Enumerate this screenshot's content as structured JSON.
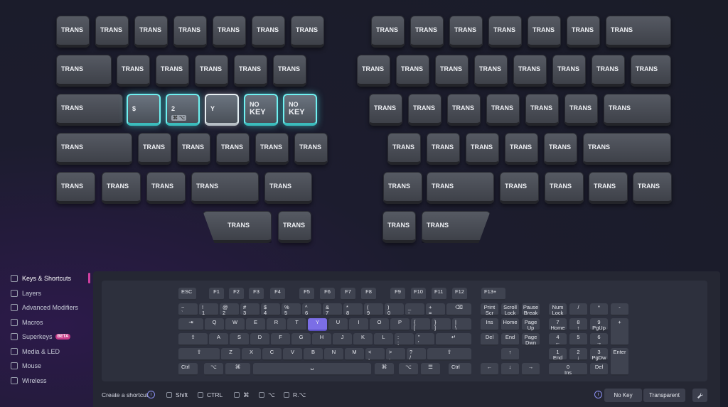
{
  "top_keyboard": {
    "left_half": [
      [
        "TRANS",
        "TRANS",
        "TRANS",
        "TRANS",
        "TRANS",
        "TRANS",
        "TRANS"
      ],
      [
        "TRANS",
        "TRANS",
        "TRANS",
        "TRANS",
        "TRANS",
        "TRANS"
      ],
      [
        "TRANS",
        "$",
        "2",
        "Y",
        "NO KEY",
        "NO KEY"
      ],
      [
        "TRANS",
        "TRANS",
        "TRANS",
        "TRANS",
        "TRANS",
        "TRANS"
      ],
      [
        "TRANS",
        "TRANS",
        "TRANS",
        "TRANS",
        "TRANS"
      ],
      [
        "TRANS",
        "TRANS"
      ]
    ],
    "right_half": [
      [
        "TRANS",
        "TRANS",
        "TRANS",
        "TRANS",
        "TRANS",
        "TRANS",
        "TRANS"
      ],
      [
        "TRANS",
        "TRANS",
        "TRANS",
        "TRANS",
        "TRANS",
        "TRANS",
        "TRANS",
        "TRANS"
      ],
      [
        "TRANS",
        "TRANS",
        "TRANS",
        "TRANS",
        "TRANS",
        "TRANS",
        "TRANS"
      ],
      [
        "TRANS",
        "TRANS",
        "TRANS",
        "TRANS",
        "TRANS",
        "TRANS"
      ],
      [
        "TRANS",
        "TRANS",
        "TRANS",
        "TRANS",
        "TRANS",
        "TRANS"
      ],
      [
        "TRANS",
        "TRANS"
      ]
    ],
    "selected": {
      "dollar": "$",
      "two": "2",
      "two_mods": "⌘ ⌥",
      "y": "Y",
      "nokey1_line1": "NO",
      "nokey1_line2": "KEY",
      "nokey2_line1": "NO",
      "nokey2_line2": "KEY"
    }
  },
  "sidebar": {
    "items": [
      {
        "label": "Keys & Shortcuts",
        "icon": "keyboard-icon"
      },
      {
        "label": "Layers",
        "icon": "layers-icon"
      },
      {
        "label": "Advanced Modifiers",
        "icon": "modifiers-icon"
      },
      {
        "label": "Macros",
        "icon": "macros-icon"
      },
      {
        "label": "Superkeys",
        "icon": "lightning-icon",
        "badge": "BETA"
      },
      {
        "label": "Media & LED",
        "icon": "media-icon"
      },
      {
        "label": "Mouse",
        "icon": "mouse-icon"
      },
      {
        "label": "Wireless",
        "icon": "wireless-icon"
      }
    ]
  },
  "standard_keyboard": {
    "rows": [
      [
        "ESC",
        "F1",
        "F2",
        "F3",
        "F4",
        "F5",
        "F6",
        "F7",
        "F8",
        "F9",
        "F10",
        "F11",
        "F12",
        "F13+"
      ],
      [
        "~\n`",
        "!\n1",
        "@\n2",
        "#\n3",
        "$\n4",
        "%\n5",
        "^\n6",
        "&\n7",
        "*\n8",
        "(\n9",
        ")\n0",
        "_\n-",
        "+\n=",
        "⌫"
      ],
      [
        "⇥",
        "Q",
        "W",
        "E",
        "R",
        "T",
        "Y",
        "U",
        "I",
        "O",
        "P",
        "{\n[",
        "}\n]",
        "|\n\\"
      ],
      [
        "⇪",
        "A",
        "S",
        "D",
        "F",
        "G",
        "H",
        "J",
        "K",
        "L",
        ":\n;",
        "\"\n'",
        "↵"
      ],
      [
        "⇧",
        "Z",
        "X",
        "C",
        "V",
        "B",
        "N",
        "M",
        "<\n,",
        ">\n.",
        "?\n/",
        "⇧"
      ],
      [
        "Ctrl",
        "⌥",
        "⌘",
        "␣",
        "⌘",
        "⌥",
        "☰",
        "Ctrl"
      ]
    ],
    "nav": [
      "Print\nScr",
      "Scroll\nLock",
      "Pause\nBreak",
      "Ins",
      "Home",
      "Page\nUp",
      "Del",
      "End",
      "Page\nDwn",
      "↑",
      "←",
      "↓",
      "→"
    ],
    "numpad": [
      "Num\nLock",
      "/",
      "*",
      "-",
      "7\nHome",
      "8\n↑",
      "9\nPgUp",
      "+",
      "4\n←",
      "5",
      "6\n→",
      "1\nEnd",
      "2\n↓",
      "3\nPgDw",
      "Enter",
      "0\nIns",
      "Del"
    ]
  },
  "bottom_bar": {
    "create_shortcut": "Create a shortcut",
    "shift": "Shift",
    "ctrl": "CTRL",
    "cmd": "⌘",
    "alt": "⌥",
    "ralt": "R.⌥",
    "no_key": "No Key",
    "transparent": "Transparent",
    "info": "i"
  },
  "colors": {
    "selected_border": "#6ff0f0",
    "highlight": "#7b6ee6",
    "badge": "#c83c8a"
  }
}
